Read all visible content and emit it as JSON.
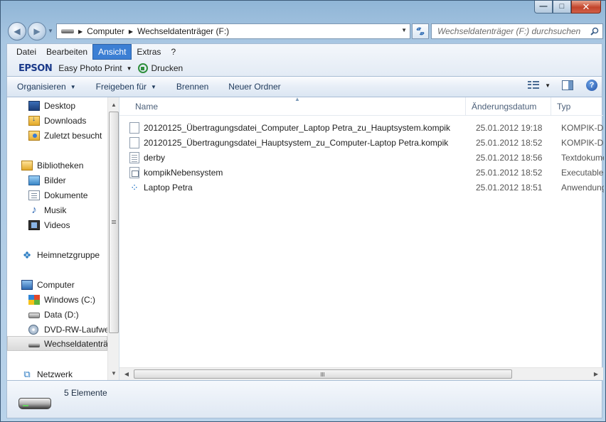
{
  "window": {
    "caption": {
      "minimize_glyph": "—",
      "maximize_glyph": "□",
      "close_glyph": "✕"
    }
  },
  "address": {
    "crumbs": [
      "Computer",
      "Wechseldatenträger (F:)"
    ],
    "search_placeholder": "Wechseldatenträger (F:) durchsuchen"
  },
  "menu": [
    "Datei",
    "Bearbeiten",
    "Ansicht",
    "Extras",
    "?"
  ],
  "menu_active": "Ansicht",
  "epson": {
    "logo": "EPSON",
    "easy_photo_print": "Easy Photo Print",
    "print": "Drucken"
  },
  "toolbar": {
    "organize": "Organisieren",
    "share": "Freigeben für",
    "burn": "Brennen",
    "new_folder": "Neuer Ordner"
  },
  "nav": {
    "items": [
      {
        "label": "Desktop",
        "icon": "desktop-icon"
      },
      {
        "label": "Downloads",
        "icon": "downloads-icon"
      },
      {
        "label": "Zuletzt besucht",
        "icon": "recent-places-icon"
      },
      {
        "label": "Bibliotheken",
        "icon": "libraries-icon"
      },
      {
        "label": "Bilder",
        "icon": "pictures-icon"
      },
      {
        "label": "Dokumente",
        "icon": "documents-icon"
      },
      {
        "label": "Musik",
        "icon": "music-icon"
      },
      {
        "label": "Videos",
        "icon": "videos-icon"
      },
      {
        "label": "Heimnetzgruppe",
        "icon": "homegroup-icon"
      },
      {
        "label": "Computer",
        "icon": "computer-icon"
      },
      {
        "label": "Windows (C:)",
        "icon": "windows-drive-icon"
      },
      {
        "label": "Data (D:)",
        "icon": "drive-icon"
      },
      {
        "label": "DVD-RW-Laufwe",
        "icon": "dvd-drive-icon"
      },
      {
        "label": "Wechseldatenträ",
        "icon": "removable-drive-icon"
      },
      {
        "label": "Netzwerk",
        "icon": "network-icon"
      }
    ],
    "selected": "Wechseldatenträ"
  },
  "columns": {
    "name": "Name",
    "date": "Änderungsdatum",
    "type": "Typ"
  },
  "files": [
    {
      "name": "20120125_Übertragungsdatei_Computer_Laptop Petra_zu_Hauptsystem.kompik",
      "date": "25.01.2012 19:18",
      "type": "KOMPIK-Datei",
      "icon": "document-icon"
    },
    {
      "name": "20120125_Übertragungsdatei_Hauptsystem_zu_Computer-Laptop Petra.kompik",
      "date": "25.01.2012 18:52",
      "type": "KOMPIK-Datei",
      "icon": "document-icon"
    },
    {
      "name": "derby",
      "date": "25.01.2012 18:56",
      "type": "Textdokument",
      "icon": "text-file-icon"
    },
    {
      "name": "kompikNebensystem",
      "date": "25.01.2012 18:52",
      "type": "Executable Jar File",
      "icon": "executable-jar-icon"
    },
    {
      "name": "Laptop Petra",
      "date": "25.01.2012 18:51",
      "type": "Anwendung",
      "icon": "application-icon"
    }
  ],
  "status": {
    "count": "5 Elemente"
  }
}
